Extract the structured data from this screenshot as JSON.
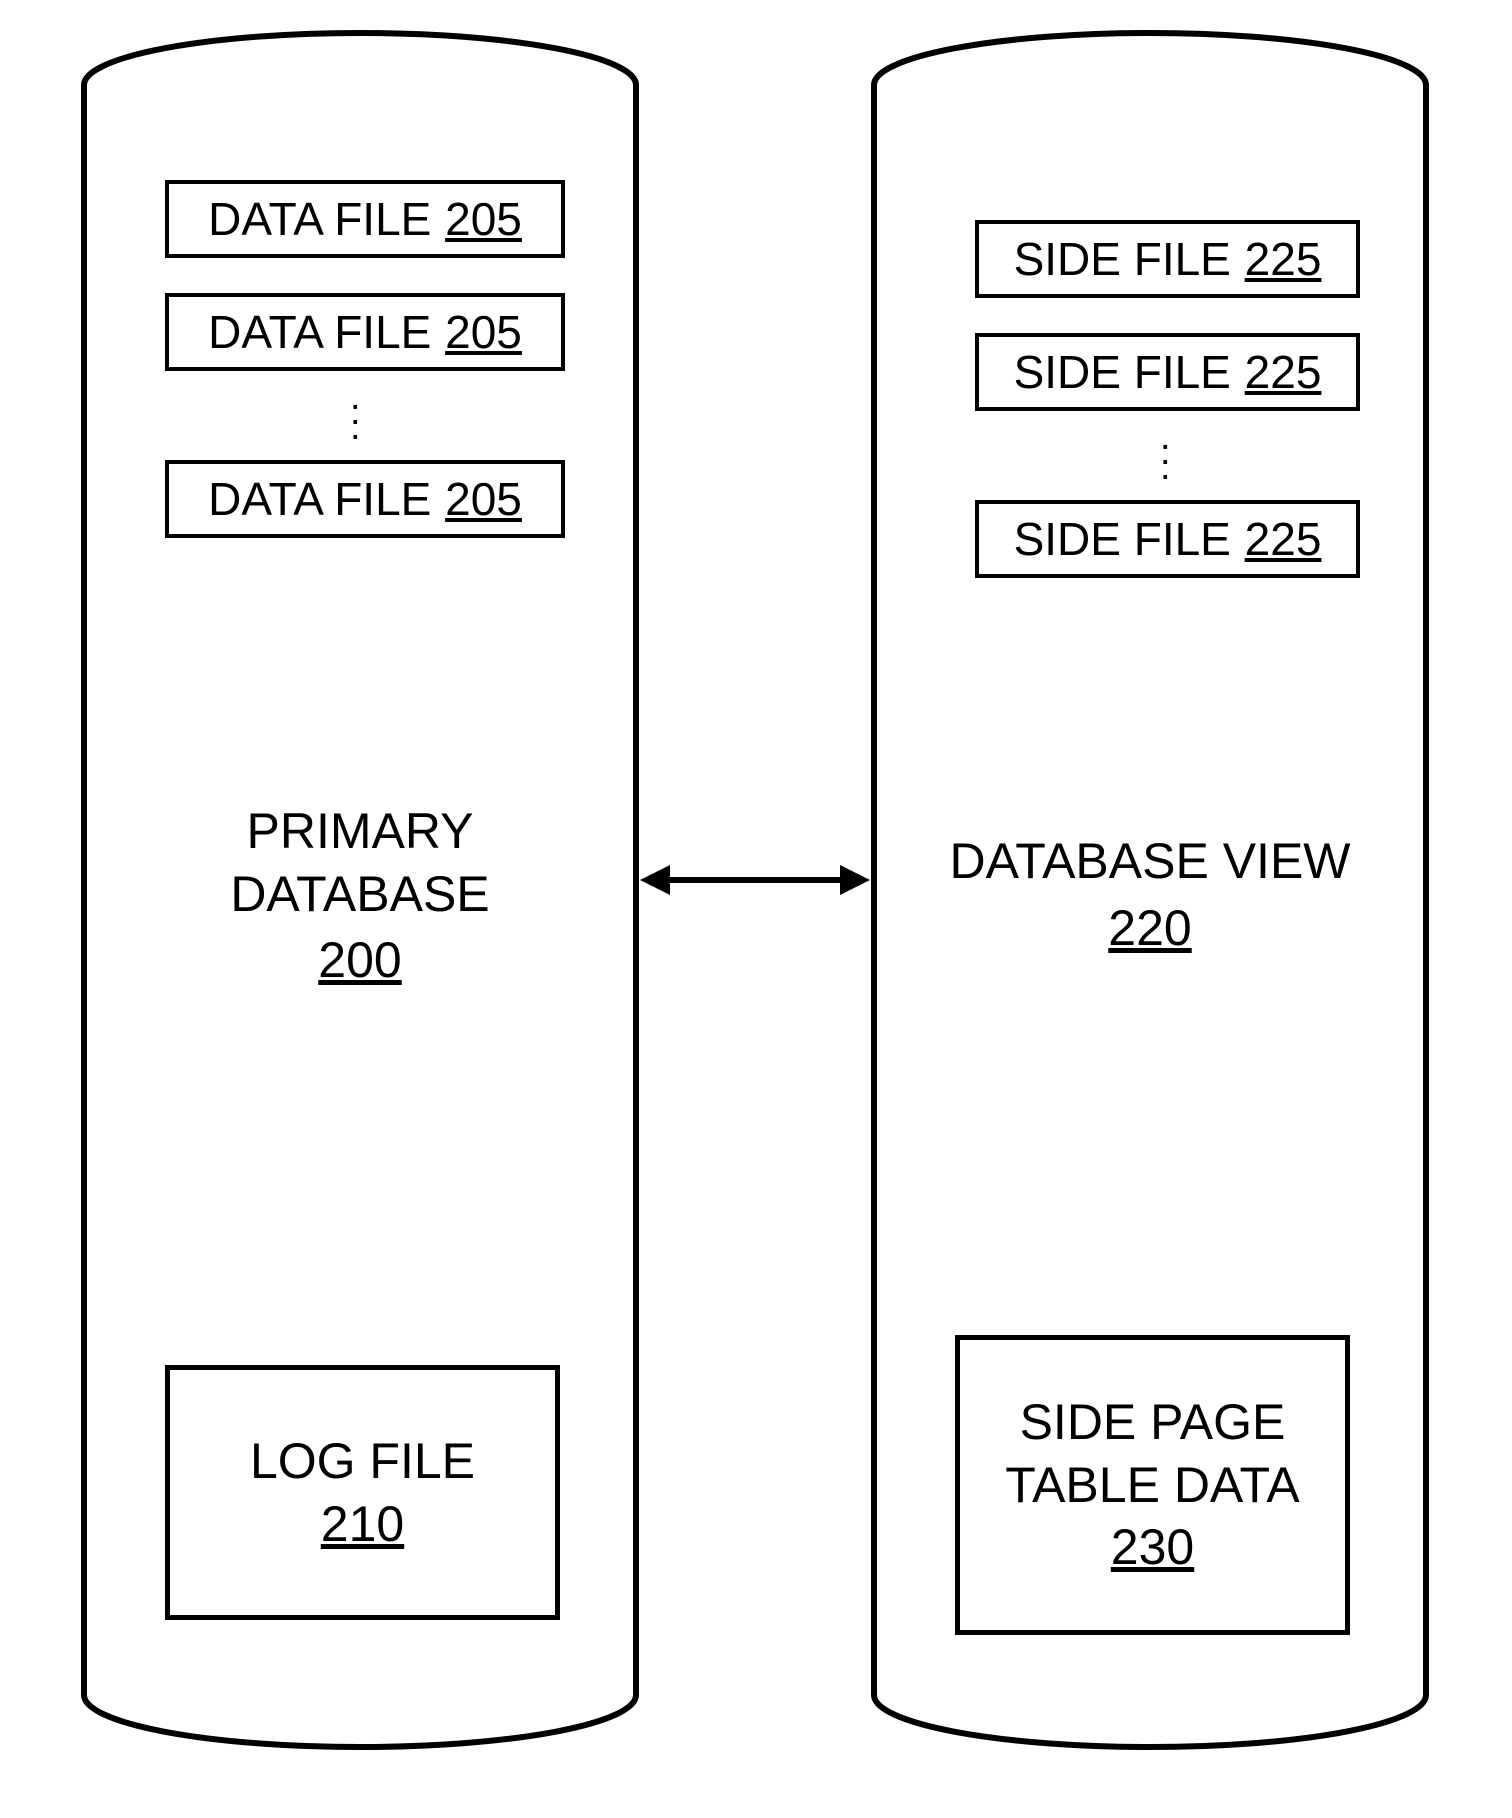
{
  "left": {
    "files": [
      {
        "label": "DATA FILE",
        "ref": "205"
      },
      {
        "label": "DATA FILE",
        "ref": "205"
      },
      {
        "label": "DATA FILE",
        "ref": "205"
      }
    ],
    "title": {
      "line1": "PRIMARY",
      "line2": "DATABASE",
      "ref": "200"
    },
    "box": {
      "line1": "LOG FILE",
      "ref": "210"
    }
  },
  "right": {
    "files": [
      {
        "label": "SIDE FILE",
        "ref": "225"
      },
      {
        "label": "SIDE FILE",
        "ref": "225"
      },
      {
        "label": "SIDE FILE",
        "ref": "225"
      }
    ],
    "title": {
      "line1": "DATABASE VIEW",
      "ref": "220"
    },
    "box": {
      "line1": "SIDE PAGE",
      "line2": "TABLE DATA",
      "ref": "230"
    }
  }
}
